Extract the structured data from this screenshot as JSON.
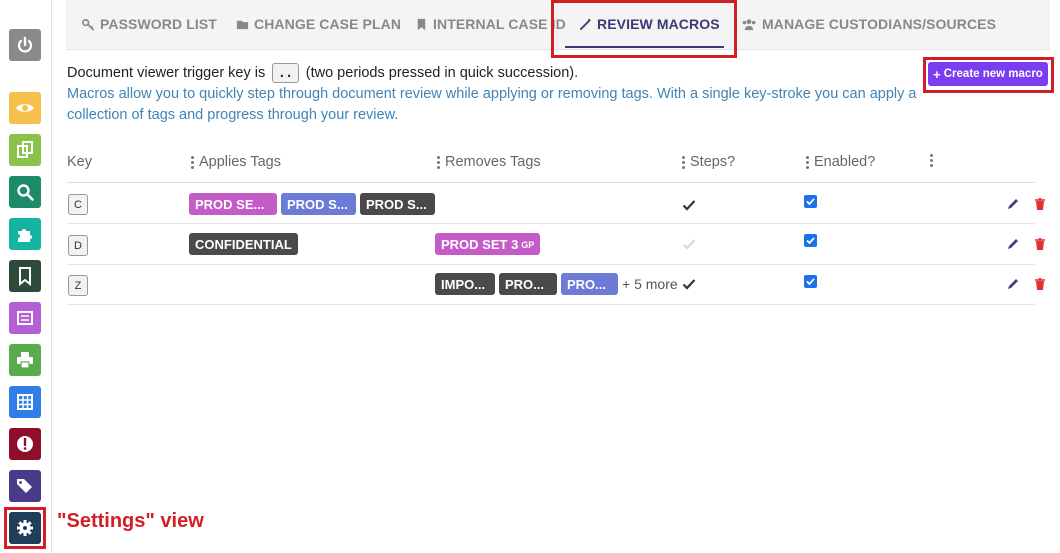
{
  "tabs": [
    {
      "label": "PASSWORD LIST",
      "icon": "key-icon"
    },
    {
      "label": "CHANGE CASE PLAN",
      "icon": "folder-icon"
    },
    {
      "label": "INTERNAL CASE ID",
      "icon": "bookmark-icon"
    },
    {
      "label": "REVIEW MACROS",
      "icon": "magic-wand-icon",
      "active": true
    },
    {
      "label": "MANAGE CUSTODIANS/SOURCES",
      "icon": "users-icon"
    }
  ],
  "info": {
    "trigger_prefix": "Document viewer trigger key is",
    "trigger_key": "..",
    "trigger_suffix": "(two periods pressed in quick succession).",
    "description": "Macros allow you to quickly step through document review while applying or removing tags. With a single key-stroke you can apply a collection of tags and progress through your review."
  },
  "create_button": {
    "icon": "+",
    "label": "Create new macro"
  },
  "table": {
    "headers": {
      "key": "Key",
      "applies": "Applies Tags",
      "removes": "Removes Tags",
      "steps": "Steps?",
      "enabled": "Enabled?"
    },
    "rows": [
      {
        "key": "C",
        "applies": [
          "PROD SE...",
          "PROD S...",
          "PROD S..."
        ],
        "removes": [],
        "removes_more": "",
        "steps": true,
        "enabled": true
      },
      {
        "key": "D",
        "applies": [
          "CONFIDENTIAL"
        ],
        "removes": [
          "PROD SET 3"
        ],
        "removes_badge": "GP",
        "removes_more": "",
        "steps": false,
        "enabled": true
      },
      {
        "key": "Z",
        "applies": [],
        "removes": [
          "IMPO...",
          "PRO...",
          "PRO..."
        ],
        "removes_more": "+ 5 more",
        "steps": true,
        "enabled": true
      }
    ]
  },
  "annotation": "\"Settings\" view",
  "colors": {
    "accent": "#3b3a78",
    "highlight": "#d21f25",
    "create_button": "#7a3df0",
    "tag_pink": "#c45cc8",
    "tag_blue": "#6b7bd6",
    "tag_dark": "#4a4a4a"
  },
  "sidebar_icons": [
    "power-icon",
    "eye-icon",
    "copy-icon",
    "search-icon",
    "puzzle-icon",
    "bookmark-icon",
    "list-icon",
    "print-icon",
    "table-icon",
    "alert-icon",
    "tags-icon",
    "gear-icon"
  ]
}
